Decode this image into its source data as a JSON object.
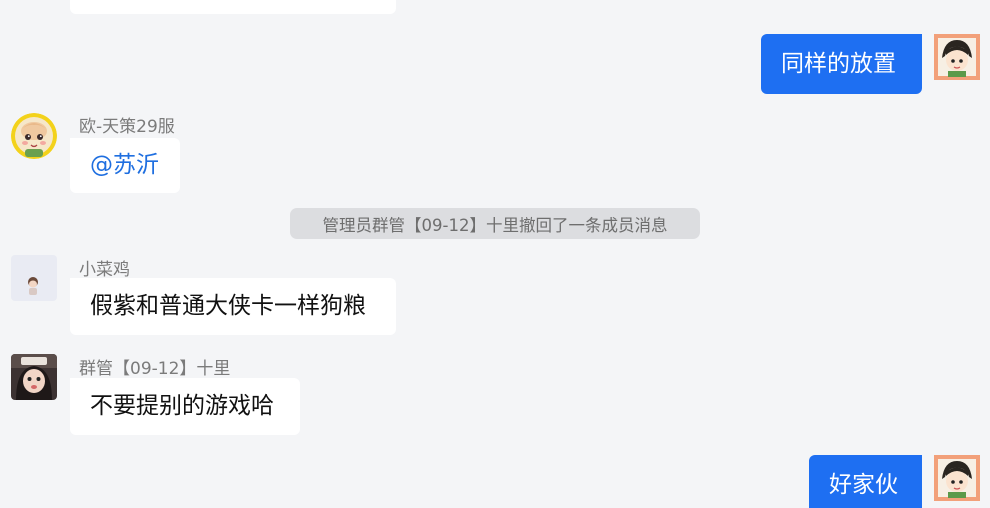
{
  "messages": {
    "m1": {
      "text": "同样的放置"
    },
    "m2": {
      "sender": "欧-天策29服",
      "text": "@苏沂"
    },
    "system": {
      "text": "管理员群管【09-12】十里撤回了一条成员消息"
    },
    "m3": {
      "sender": "小菜鸡",
      "text": "假紫和普通大侠卡一样狗粮"
    },
    "m4": {
      "sender": "群管【09-12】十里",
      "text": "不要提别的游戏哈"
    },
    "m5": {
      "text": "好家伙"
    }
  },
  "colors": {
    "background": "#f4f5f7",
    "outgoing_bubble": "#1e6ff2",
    "incoming_bubble": "#ffffff",
    "mention_text": "#1f6fe0",
    "system_pill": "#dcdde0"
  },
  "icons": {
    "self_avatar": "chibi-avatar-icon",
    "ou_avatar": "baby-face-avatar-icon",
    "xiaocaiji_avatar": "small-figure-avatar-icon",
    "qunguan_avatar": "girl-photo-avatar-icon"
  }
}
